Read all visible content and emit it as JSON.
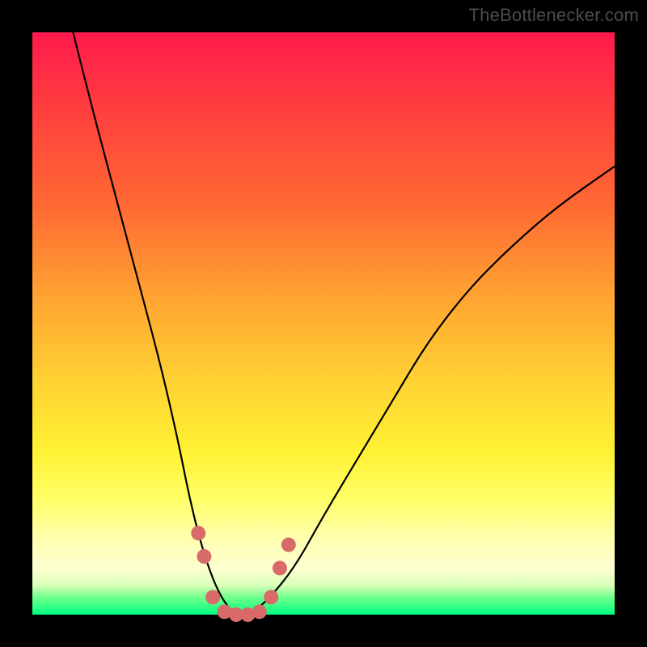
{
  "watermark": {
    "text": "TheBottlenecker.com"
  },
  "chart_data": {
    "type": "line",
    "title": "",
    "xlabel": "",
    "ylabel": "",
    "xlim": [
      0,
      100
    ],
    "ylim": [
      0,
      100
    ],
    "grid": false,
    "series": [
      {
        "name": "bottleneck-curve",
        "x": [
          7,
          10,
          14,
          18,
          22,
          25,
          27,
          29,
          31,
          33,
          35,
          37,
          40,
          45,
          50,
          56,
          62,
          68,
          75,
          82,
          90,
          100
        ],
        "values": [
          100,
          88,
          73,
          58,
          43,
          30,
          20,
          12,
          6,
          2,
          0,
          0,
          2,
          8,
          17,
          27,
          37,
          47,
          56,
          63,
          70,
          77
        ]
      }
    ],
    "markers": {
      "name": "highlight-dots",
      "color": "#d96a6a",
      "x": [
        28.5,
        29.5,
        31,
        33,
        35,
        37,
        39,
        41,
        42.5,
        44
      ],
      "values": [
        14,
        10,
        3,
        0.5,
        0,
        0,
        0.5,
        3,
        8,
        12
      ]
    },
    "gradient_stops": [
      {
        "pos": 0,
        "color": "#ff1a4d"
      },
      {
        "pos": 30,
        "color": "#ff6a33"
      },
      {
        "pos": 60,
        "color": "#ffd233"
      },
      {
        "pos": 87,
        "color": "#ffffb0"
      },
      {
        "pos": 97,
        "color": "#72ff8c"
      },
      {
        "pos": 100,
        "color": "#00ff7f"
      }
    ]
  }
}
